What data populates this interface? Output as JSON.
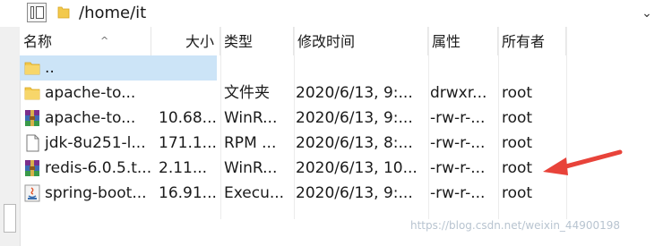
{
  "path_bar": {
    "path": "/home/it",
    "dropdown_glyph": "⌄"
  },
  "columns": {
    "name": "名称",
    "size": "大小",
    "type": "类型",
    "modified": "修改时间",
    "attributes": "属性",
    "owner": "所有者",
    "sort_glyph": "^"
  },
  "files": [
    {
      "name": "..",
      "size": "",
      "type": "",
      "modified": "",
      "attributes": "",
      "owner": "",
      "icon": "folder-icon",
      "selected": true
    },
    {
      "name": "apache-to...",
      "size": "",
      "type": "文件夹",
      "modified": "2020/6/13, 9:...",
      "attributes": "drwxr...",
      "owner": "root",
      "icon": "folder-icon"
    },
    {
      "name": "apache-to...",
      "size": "10.68...",
      "type": "WinR...",
      "modified": "2020/6/13, 9:...",
      "attributes": "-rw-r-...",
      "owner": "root",
      "icon": "winrar-archive-icon"
    },
    {
      "name": "jdk-8u251-l...",
      "size": "171.1...",
      "type": "RPM ...",
      "modified": "2020/6/13, 8:...",
      "attributes": "-rw-r-...",
      "owner": "root",
      "icon": "blank-file-icon"
    },
    {
      "name": "redis-6.0.5.t...",
      "size": "2.11...",
      "type": "WinR...",
      "modified": "2020/6/13, 10...",
      "attributes": "-rw-r-...",
      "owner": "root",
      "icon": "winrar-archive-icon"
    },
    {
      "name": "spring-boot...",
      "size": "16.91...",
      "type": "Execu...",
      "modified": "2020/6/13, 9:...",
      "attributes": "-rw-r-...",
      "owner": "root",
      "icon": "java-jar-icon"
    }
  ],
  "watermark": "https://blog.csdn.net/weixin_44900198",
  "colors": {
    "selection": "#cce4f7",
    "folder": "#f2c94c",
    "annotation_arrow": "#e8433a"
  }
}
